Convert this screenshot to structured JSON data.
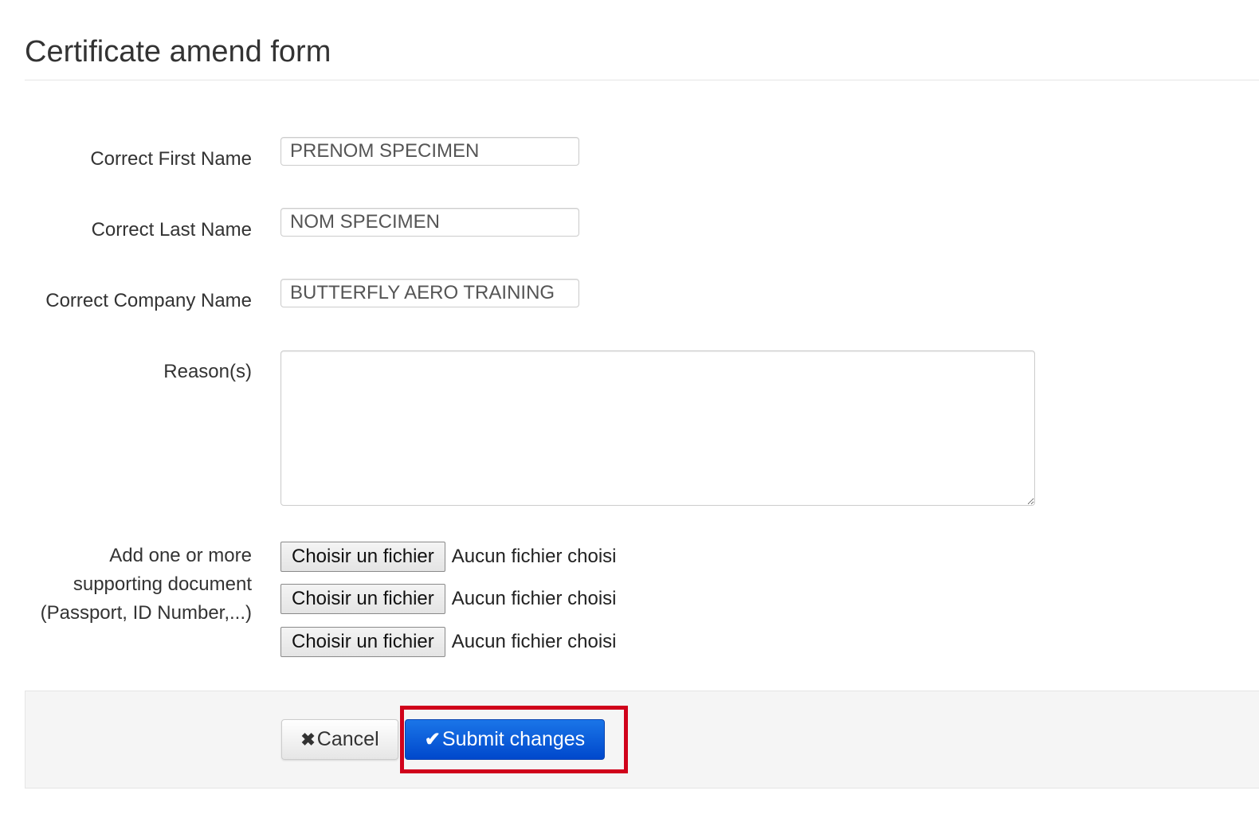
{
  "form": {
    "title": "Certificate amend form",
    "first_name": {
      "label": "Correct First Name",
      "value": "PRENOM SPECIMEN"
    },
    "last_name": {
      "label": "Correct Last Name",
      "value": "NOM SPECIMEN"
    },
    "company_name": {
      "label": "Correct Company Name",
      "value": "BUTTERFLY AERO TRAINING"
    },
    "reasons": {
      "label": "Reason(s)",
      "value": ""
    },
    "documents": {
      "label_lines": [
        "Add one or more",
        "supporting document",
        "(Passport, ID Number,...)"
      ],
      "files": [
        {
          "button_label": "Choisir un fichier",
          "status": "Aucun fichier choisi"
        },
        {
          "button_label": "Choisir un fichier",
          "status": "Aucun fichier choisi"
        },
        {
          "button_label": "Choisir un fichier",
          "status": "Aucun fichier choisi"
        }
      ]
    }
  },
  "actions": {
    "cancel_label": "Cancel",
    "cancel_icon": "✖",
    "submit_label": "Submit changes",
    "submit_icon": "✔",
    "submit_color": "#0048cc",
    "highlight_color": "#d0021b"
  }
}
